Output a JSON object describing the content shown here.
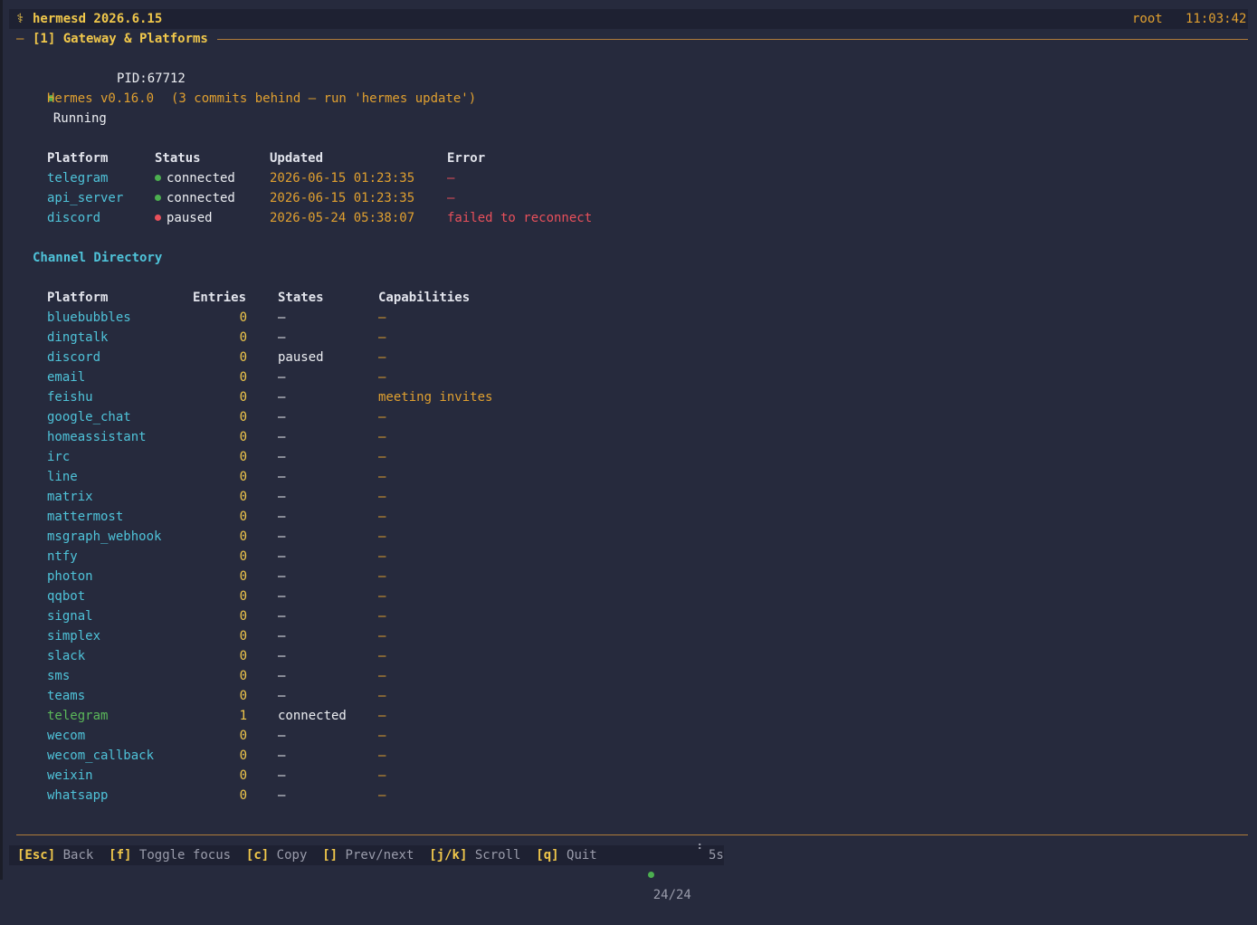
{
  "header": {
    "icon": "⚕",
    "title": "hermesd 2026.6.15",
    "user": "root",
    "time": "11:03:42"
  },
  "section": {
    "dash": "—",
    "label": "[1] Gateway & Platforms"
  },
  "status": {
    "state": "Running",
    "pid": "PID:67712",
    "version": "Hermes v0.16.0",
    "update_note": "(3 commits behind — run 'hermes update')"
  },
  "platforms_table": {
    "headers": [
      "Platform",
      "Status",
      "Updated",
      "Error"
    ],
    "rows": [
      {
        "platform": "telegram",
        "status": "connected",
        "status_color": "#4caf50",
        "updated": "2026-06-15 01:23:35",
        "error": "—"
      },
      {
        "platform": "api_server",
        "status": "connected",
        "status_color": "#4caf50",
        "updated": "2026-06-15 01:23:35",
        "error": "—"
      },
      {
        "platform": "discord",
        "status": "paused",
        "status_color": "#e8505b",
        "updated": "2026-05-24 05:38:07",
        "error": "failed to reconnect"
      }
    ]
  },
  "channel_directory": {
    "title": "Channel Directory",
    "headers": [
      "Platform",
      "Entries",
      "States",
      "Capabilities"
    ],
    "rows": [
      {
        "platform": "bluebubbles",
        "entries": "0",
        "states": "—",
        "capabilities": "—"
      },
      {
        "platform": "dingtalk",
        "entries": "0",
        "states": "—",
        "capabilities": "—"
      },
      {
        "platform": "discord",
        "entries": "0",
        "states": "paused",
        "capabilities": "—"
      },
      {
        "platform": "email",
        "entries": "0",
        "states": "—",
        "capabilities": "—"
      },
      {
        "platform": "feishu",
        "entries": "0",
        "states": "—",
        "capabilities": "meeting invites"
      },
      {
        "platform": "google_chat",
        "entries": "0",
        "states": "—",
        "capabilities": "—"
      },
      {
        "platform": "homeassistant",
        "entries": "0",
        "states": "—",
        "capabilities": "—"
      },
      {
        "platform": "irc",
        "entries": "0",
        "states": "—",
        "capabilities": "—"
      },
      {
        "platform": "line",
        "entries": "0",
        "states": "—",
        "capabilities": "—"
      },
      {
        "platform": "matrix",
        "entries": "0",
        "states": "—",
        "capabilities": "—"
      },
      {
        "platform": "mattermost",
        "entries": "0",
        "states": "—",
        "capabilities": "—"
      },
      {
        "platform": "msgraph_webhook",
        "entries": "0",
        "states": "—",
        "capabilities": "—"
      },
      {
        "platform": "ntfy",
        "entries": "0",
        "states": "—",
        "capabilities": "—"
      },
      {
        "platform": "photon",
        "entries": "0",
        "states": "—",
        "capabilities": "—"
      },
      {
        "platform": "qqbot",
        "entries": "0",
        "states": "—",
        "capabilities": "—"
      },
      {
        "platform": "signal",
        "entries": "0",
        "states": "—",
        "capabilities": "—"
      },
      {
        "platform": "simplex",
        "entries": "0",
        "states": "—",
        "capabilities": "—"
      },
      {
        "platform": "slack",
        "entries": "0",
        "states": "—",
        "capabilities": "—"
      },
      {
        "platform": "sms",
        "entries": "0",
        "states": "—",
        "capabilities": "—"
      },
      {
        "platform": "teams",
        "entries": "0",
        "states": "—",
        "capabilities": "—"
      },
      {
        "platform": "telegram",
        "entries": "1",
        "states": "connected",
        "capabilities": "—",
        "active": true
      },
      {
        "platform": "wecom",
        "entries": "0",
        "states": "—",
        "capabilities": "—"
      },
      {
        "platform": "wecom_callback",
        "entries": "0",
        "states": "—",
        "capabilities": "—"
      },
      {
        "platform": "weixin",
        "entries": "0",
        "states": "—",
        "capabilities": "—"
      },
      {
        "platform": "whatsapp",
        "entries": "0",
        "states": "—",
        "capabilities": "—"
      }
    ]
  },
  "footer": {
    "shortcuts": [
      {
        "key": "[Esc]",
        "label": "Back"
      },
      {
        "key": "[f]",
        "label": "Toggle focus"
      },
      {
        "key": "[c]",
        "label": "Copy"
      },
      {
        "key": "[]",
        "label": "Prev/next"
      },
      {
        "key": "[j/k]",
        "label": "Scroll"
      },
      {
        "key": "[q]",
        "label": "Quit"
      }
    ],
    "count": "24/24",
    "spinner": "⠘",
    "interval": "5s"
  },
  "colors": {
    "background": "#262a3d",
    "accent_yellow": "#f1c84b",
    "accent_orange": "#e0a030",
    "platform_cyan": "#4fc3d9",
    "ok_green": "#4caf50",
    "error_red": "#e8505b",
    "divider": "#b07c3a"
  }
}
